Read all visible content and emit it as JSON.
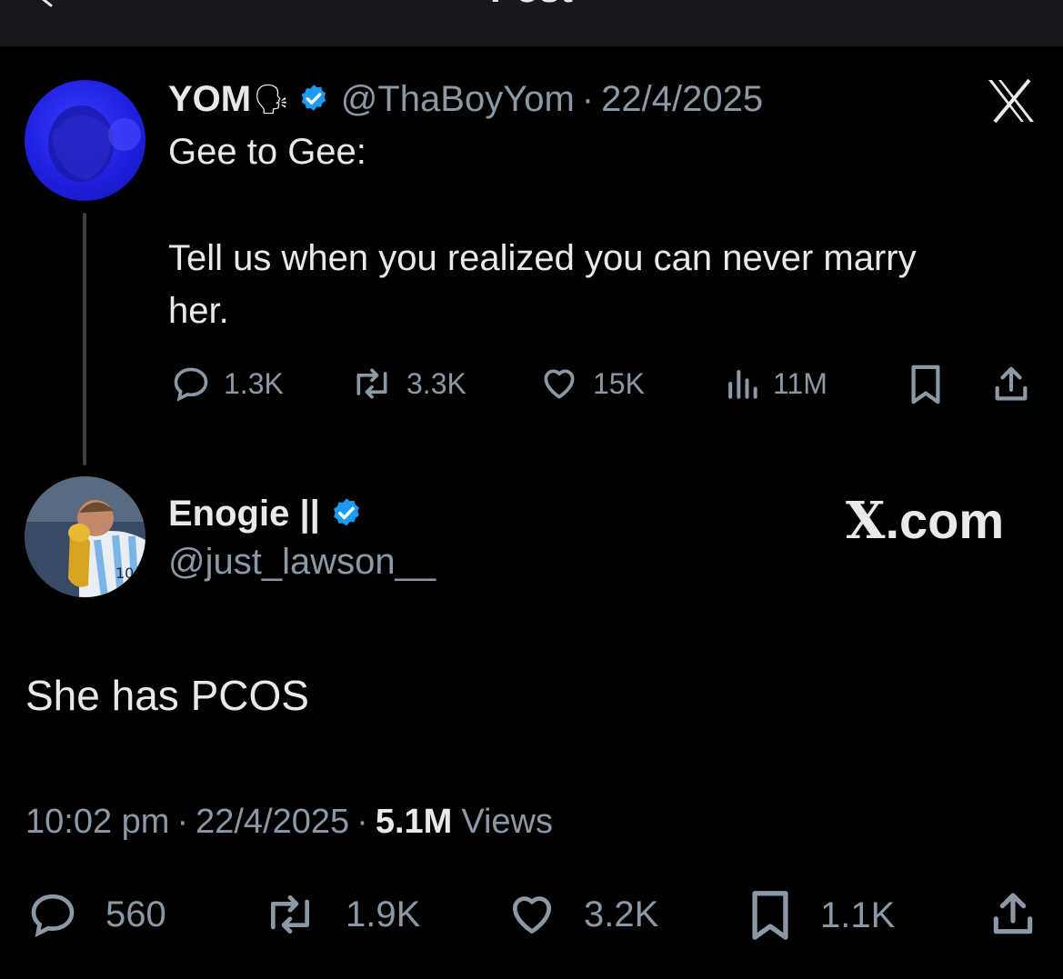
{
  "topbar": {
    "title": "Post"
  },
  "quoted": {
    "name": "YOM",
    "emoji": "🗣",
    "handle": "@ThaBoyYom",
    "date": "22/4/2025",
    "text_line1": "Gee to Gee:",
    "text_line2": "Tell us when you realized you can never marry",
    "text_line3": "her.",
    "replies": "1.3K",
    "reposts": "3.3K",
    "likes": "15K",
    "views": "11M"
  },
  "reply": {
    "name": "Enogie ||",
    "handle": "@just_lawson__",
    "text": "She has PCOS",
    "time": "10:02 pm",
    "date": "22/4/2025",
    "view_count": "5.1M",
    "views_label": "Views",
    "replies": "560",
    "reposts": "1.9K",
    "likes": "3.2K",
    "bookmarks": "1.1K"
  },
  "watermark": {
    "x": "X",
    "domain": ".com"
  },
  "colors": {
    "accent": "#1d9bf0",
    "muted": "#8b98a5",
    "text": "#e7e9ea",
    "background": "#000000"
  }
}
